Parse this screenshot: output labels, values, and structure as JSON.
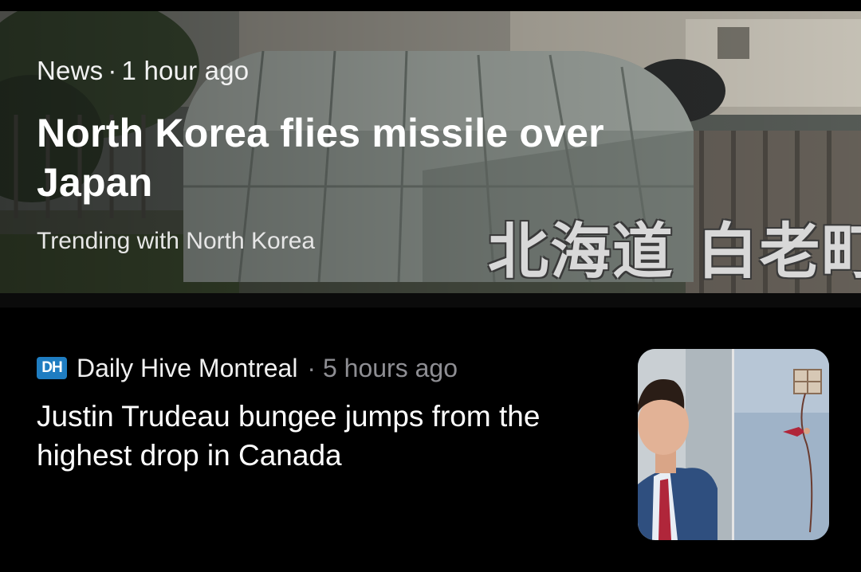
{
  "hero_card": {
    "source": "News",
    "separator": "·",
    "time": "1 hour ago",
    "headline": "North Korea flies missile over Japan",
    "trending": "Trending with North Korea",
    "image_caption": "北海道 白老町"
  },
  "story_card": {
    "source_logo_text": "DH",
    "source_logo_color": "#1f7dc1",
    "source": "Daily Hive Montreal",
    "separator": "·",
    "time": "5 hours ago",
    "headline": "Justin Trudeau bungee jumps from the highest drop in Canada"
  },
  "colors": {
    "background": "#000000",
    "primary_text": "#ffffff",
    "secondary_text": "#8e8e93"
  }
}
